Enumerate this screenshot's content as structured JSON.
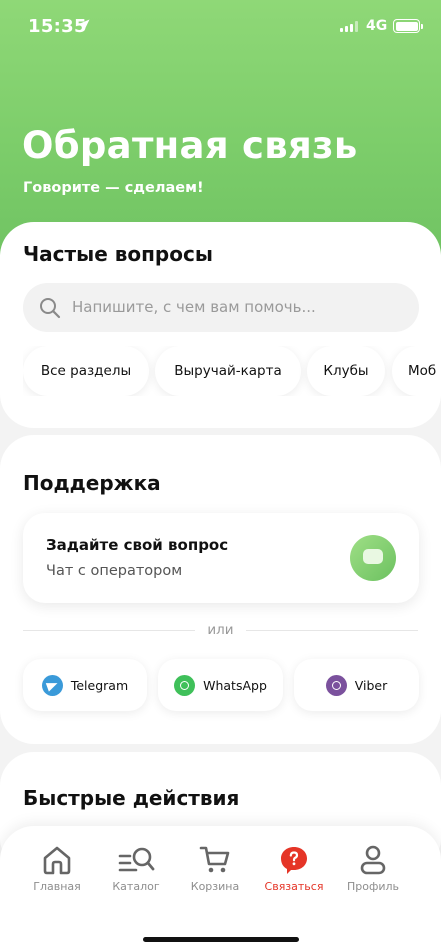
{
  "status_bar": {
    "time": "15:35",
    "network": "4G"
  },
  "header": {
    "title": "Обратная связь",
    "subtitle": "Говорите — сделаем!"
  },
  "faq": {
    "title": "Частые вопросы",
    "search_placeholder": "Напишите, с чем вам помочь...",
    "chips": [
      "Все разделы",
      "Выручай-карта",
      "Клубы",
      "Моб"
    ]
  },
  "support": {
    "title": "Поддержка",
    "ask_title": "Задайте свой вопрос",
    "ask_subtitle": "Чат с оператором",
    "divider_text": "или",
    "messengers": [
      "Telegram",
      "WhatsApp",
      "Viber"
    ]
  },
  "quick_actions": {
    "title": "Быстрые действия"
  },
  "tabbar": {
    "active": "Связаться",
    "items": [
      "Главная",
      "Каталог",
      "Корзина",
      "Связаться",
      "Профиль"
    ]
  },
  "colors": {
    "accent_green": "#7ccd6a",
    "active_tab": "#e53527",
    "telegram": "#3a9ad9",
    "whatsapp": "#3fc05a",
    "viber": "#7b519d"
  }
}
